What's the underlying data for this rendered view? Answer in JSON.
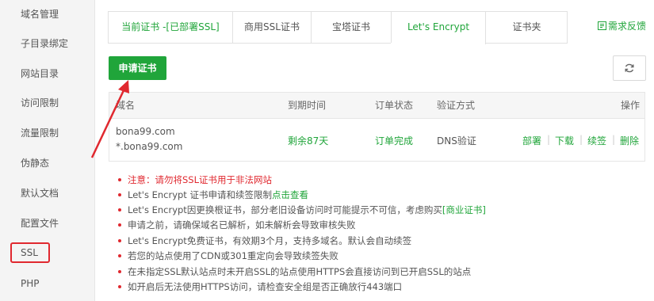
{
  "sidebar": {
    "items": [
      {
        "label": "域名管理"
      },
      {
        "label": "子目录绑定"
      },
      {
        "label": "网站目录"
      },
      {
        "label": "访问限制"
      },
      {
        "label": "流量限制"
      },
      {
        "label": "伪静态"
      },
      {
        "label": "默认文档"
      },
      {
        "label": "配置文件"
      },
      {
        "label": "SSL"
      },
      {
        "label": "PHP"
      }
    ]
  },
  "tabs": [
    {
      "label": "当前证书 -[已部署SSL]"
    },
    {
      "label": "商用SSL证书"
    },
    {
      "label": "宝塔证书"
    },
    {
      "label": "Let's Encrypt"
    },
    {
      "label": "证书夹"
    }
  ],
  "feedback_label": "需求反馈",
  "apply_button": "申请证书",
  "table": {
    "headers": {
      "domain": "域名",
      "expire": "到期时间",
      "status": "订单状态",
      "verify": "验证方式",
      "ops": "操作"
    },
    "row": {
      "domain1": "bona99.com",
      "domain2": "*.bona99.com",
      "expire": "剩余87天",
      "status": "订单完成",
      "verify": "DNS验证",
      "ops": [
        "部署",
        "下载",
        "续签",
        "删除"
      ]
    }
  },
  "notes": {
    "n1": "注意：请勿将SSL证书用于非法网站",
    "n2_text": "Let's Encrypt 证书申请和续签限制",
    "n2_link": "点击查看",
    "n3_text": "Let's Encrypt因更换根证书，部分老旧设备访问时可能提示不可信，考虑购买",
    "n3_link": "[商业证书]",
    "n4": "申请之前，请确保域名已解析，如未解析会导致审核失败",
    "n5": "Let's Encrypt免费证书，有效期3个月，支持多域名。默认会自动续签",
    "n6": "若您的站点使用了CDN或301重定向会导致续签失败",
    "n7": "在未指定SSL默认站点时未开启SSL的站点使用HTTPS会直接访问到已开启SSL的站点",
    "n8": "如开启后无法使用HTTPS访问，请检查安全组是否正确放行443端口"
  },
  "colors": {
    "accent": "#20a53a",
    "danger": "#e0282f"
  }
}
